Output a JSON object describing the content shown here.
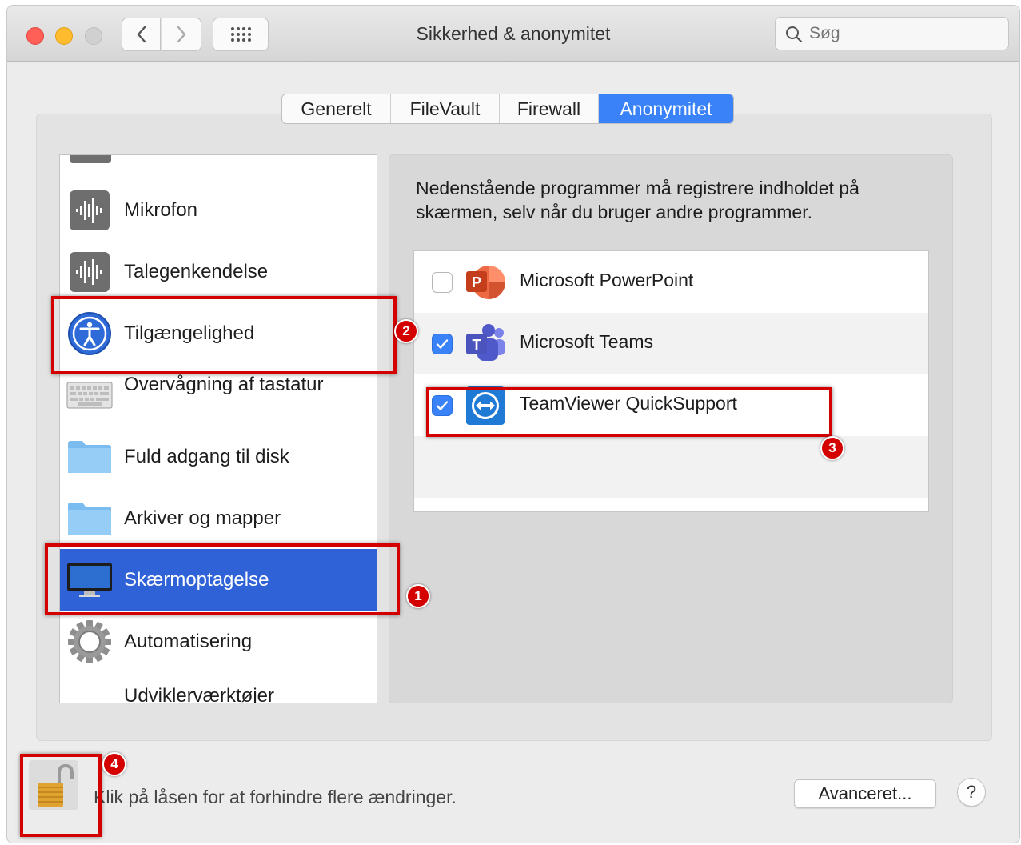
{
  "window": {
    "title": "Sikkerhed & anonymitet",
    "search_placeholder": "Søg"
  },
  "tabs": [
    {
      "label": "Generelt",
      "active": false
    },
    {
      "label": "FileVault",
      "active": false
    },
    {
      "label": "Firewall",
      "active": false
    },
    {
      "label": "Anonymitet",
      "active": true
    }
  ],
  "sidebar": {
    "items": [
      {
        "label": "Mikrofon",
        "icon": "microphone-waveform-icon",
        "selected": false
      },
      {
        "label": "Talegenkendelse",
        "icon": "speech-recognition-waveform-icon",
        "selected": false
      },
      {
        "label": "Tilgængelighed",
        "icon": "accessibility-icon",
        "selected": false
      },
      {
        "label": "Overvågning af tastatur",
        "icon": "keyboard-icon",
        "selected": false
      },
      {
        "label": "Fuld adgang til disk",
        "icon": "folder-icon",
        "selected": false
      },
      {
        "label": "Arkiver og mapper",
        "icon": "folder-icon",
        "selected": false
      },
      {
        "label": "Skærmoptagelse",
        "icon": "display-icon",
        "selected": true
      },
      {
        "label": "Automatisering",
        "icon": "gear-icon",
        "selected": false
      },
      {
        "label": "Udviklerværktøjer",
        "icon": "",
        "selected": false
      }
    ]
  },
  "main": {
    "description": "Nedenstående programmer må registrere indholdet på skærmen, selv når du bruger andre programmer.",
    "apps": [
      {
        "label": "Microsoft PowerPoint",
        "checked": false,
        "icon": "powerpoint-icon"
      },
      {
        "label": "Microsoft Teams",
        "checked": true,
        "icon": "teams-icon"
      },
      {
        "label": "TeamViewer QuickSupport",
        "checked": true,
        "icon": "teamviewer-icon"
      }
    ]
  },
  "footer": {
    "lock_text": "Klik på låsen for at forhindre flere ændringer.",
    "advanced_label": "Avanceret...",
    "help_label": "?"
  },
  "annotations": [
    "1",
    "2",
    "3",
    "4"
  ],
  "colors": {
    "selection": "#2f62d6",
    "tab_active": "#3a82f7",
    "annotation": "#d40000"
  }
}
